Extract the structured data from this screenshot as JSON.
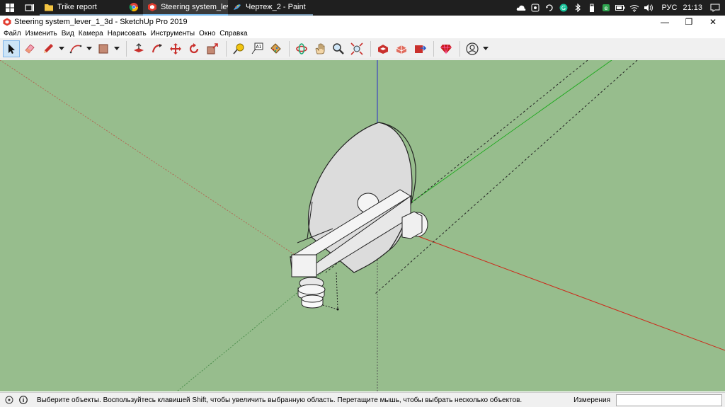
{
  "taskbar": {
    "tasks": [
      {
        "label": "Trike report",
        "icon": "folder-icon"
      },
      {
        "label": "",
        "icon": "chrome-icon"
      },
      {
        "label": "Steering system_lever...",
        "icon": "sketchup-icon"
      },
      {
        "label": "Чертеж_2 - Paint",
        "icon": "paint-icon"
      }
    ],
    "language": "РУС",
    "time": "21:13"
  },
  "window": {
    "title": "Steering system_lever_1_3d - SketchUp Pro 2019",
    "controls": {
      "minimize": "—",
      "restore": "❐",
      "close": "✕"
    }
  },
  "menu": [
    "Файл",
    "Изменить",
    "Вид",
    "Камера",
    "Нарисовать",
    "Инструменты",
    "Окно",
    "Справка"
  ],
  "toolbar": {
    "tools": [
      "select-tool",
      "eraser-tool",
      "line-tool",
      "arc-tool",
      "shapes-tool",
      "push-pull-tool",
      "follow-me-tool",
      "move-tool",
      "rotate-tool",
      "scale-tool",
      "tape-measure-tool",
      "text-tool",
      "paint-bucket-tool",
      "orbit-tool",
      "pan-tool",
      "zoom-tool",
      "zoom-extents-tool",
      "3d-warehouse-tool",
      "extension-warehouse-tool",
      "layout-tool",
      "ruby-tool",
      "account-tool"
    ]
  },
  "statusbar": {
    "text": "Выберите объекты. Воспользуйтесь клавишей Shift, чтобы увеличить выбранную область. Перетащите мышь, чтобы выбрать несколько объектов.",
    "measurements_label": "Измерения",
    "measurements_value": ""
  },
  "colors": {
    "viewport_bg": "#97bd8d",
    "axis_red": "#cc2a1a",
    "axis_green": "#22aa22",
    "axis_blue": "#2a2acc"
  }
}
